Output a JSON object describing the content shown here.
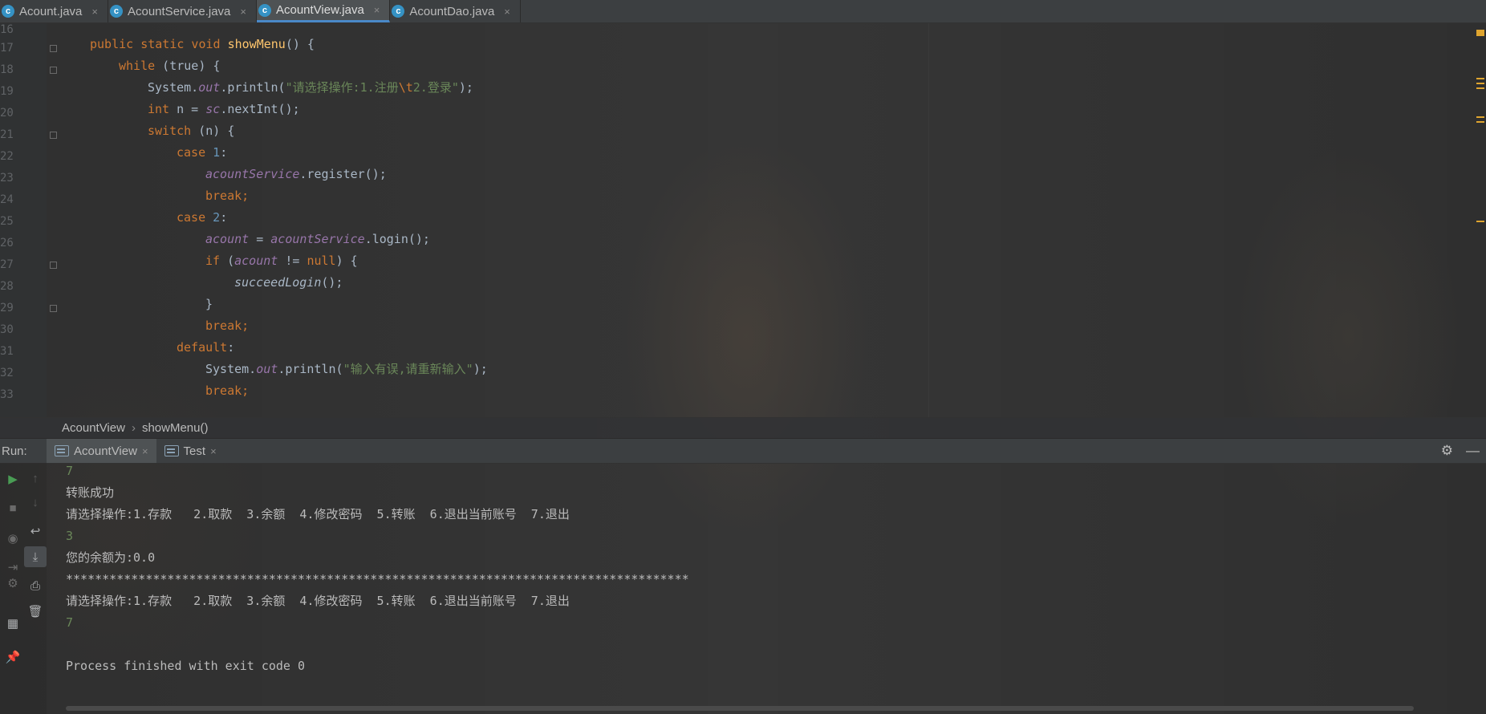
{
  "tabs": [
    {
      "label": "Acount.java",
      "active": false
    },
    {
      "label": "AcountService.java",
      "active": false
    },
    {
      "label": "AcountView.java",
      "active": true
    },
    {
      "label": "AcountDao.java",
      "active": false
    }
  ],
  "tab_close_glyph": "×",
  "class_icon_letter": "c",
  "line_numbers": [
    "16",
    "17",
    "18",
    "19",
    "20",
    "21",
    "22",
    "23",
    "24",
    "25",
    "26",
    "27",
    "28",
    "29",
    "30",
    "31",
    "32",
    "33"
  ],
  "code": {
    "l17": {
      "kw1": "public static void ",
      "method": "showMenu",
      "rest": "() {"
    },
    "l18": {
      "kw": "while",
      "rest": " (true) {"
    },
    "l19": {
      "a": "System.",
      "field": "out",
      "b": ".println(",
      "str1": "\"请选择操作:1.注册",
      "esc": "\\t",
      "str2": "2.登录\"",
      "c": ");"
    },
    "l20": {
      "kw": "int",
      "rest": " n = ",
      "field": "sc",
      "b": ".nextInt();"
    },
    "l21": {
      "kw": "switch",
      "rest": " (n) {"
    },
    "l22": {
      "kw": "case ",
      "num": "1",
      "rest": ":"
    },
    "l23": {
      "field": "acountService",
      "rest": ".register();"
    },
    "l24": {
      "kw": "break",
      "rest": ";"
    },
    "l25": {
      "kw": "case ",
      "num": "2",
      "rest": ":"
    },
    "l26": {
      "field1": "acount",
      "a": " = ",
      "field2": "acountService",
      "b": ".login();"
    },
    "l27": {
      "kw": "if",
      "a": " (",
      "field": "acount",
      "b": " != ",
      "kw2": "null",
      "c": ") {"
    },
    "l28": {
      "method": "succeedLogin",
      "rest": "();"
    },
    "l29": {
      "rest": "}"
    },
    "l30": {
      "kw": "break",
      "rest": ";"
    },
    "l31": {
      "kw": "default",
      "rest": ":"
    },
    "l32": {
      "a": "System.",
      "field": "out",
      "b": ".println(",
      "str": "\"输入有误,请重新输入\"",
      "c": ");"
    },
    "l33": {
      "kw": "break",
      "rest": ";"
    }
  },
  "breadcrumb": {
    "class": "AcountView",
    "sep": "›",
    "method": "showMenu()"
  },
  "run": {
    "label": "Run:",
    "tabs": [
      {
        "label": "AcountView",
        "active": true
      },
      {
        "label": "Test",
        "active": false
      }
    ],
    "settings_glyph": "⚙",
    "minimize_glyph": "—"
  },
  "console": {
    "lines": [
      {
        "text": "7",
        "input": true
      },
      {
        "text": "转账成功",
        "input": false
      },
      {
        "text": "请选择操作:1.存款   2.取款  3.余额  4.修改密码  5.转账  6.退出当前账号  7.退出",
        "input": false
      },
      {
        "text": "3",
        "input": true
      },
      {
        "text": "您的余额为:0.0",
        "input": false
      },
      {
        "text": "**************************************************************************************",
        "input": false
      },
      {
        "text": "请选择操作:1.存款   2.取款  3.余额  4.修改密码  5.转账  6.退出当前账号  7.退出",
        "input": false
      },
      {
        "text": "7",
        "input": true
      },
      {
        "text": "",
        "input": false
      },
      {
        "text": "Process finished with exit code 0",
        "input": false
      }
    ]
  },
  "colors": {
    "keyword": "#cc7832",
    "string": "#6a8759",
    "number": "#6897bb",
    "field": "#9876aa",
    "method": "#ffc66d",
    "accent": "#4a88c7"
  }
}
